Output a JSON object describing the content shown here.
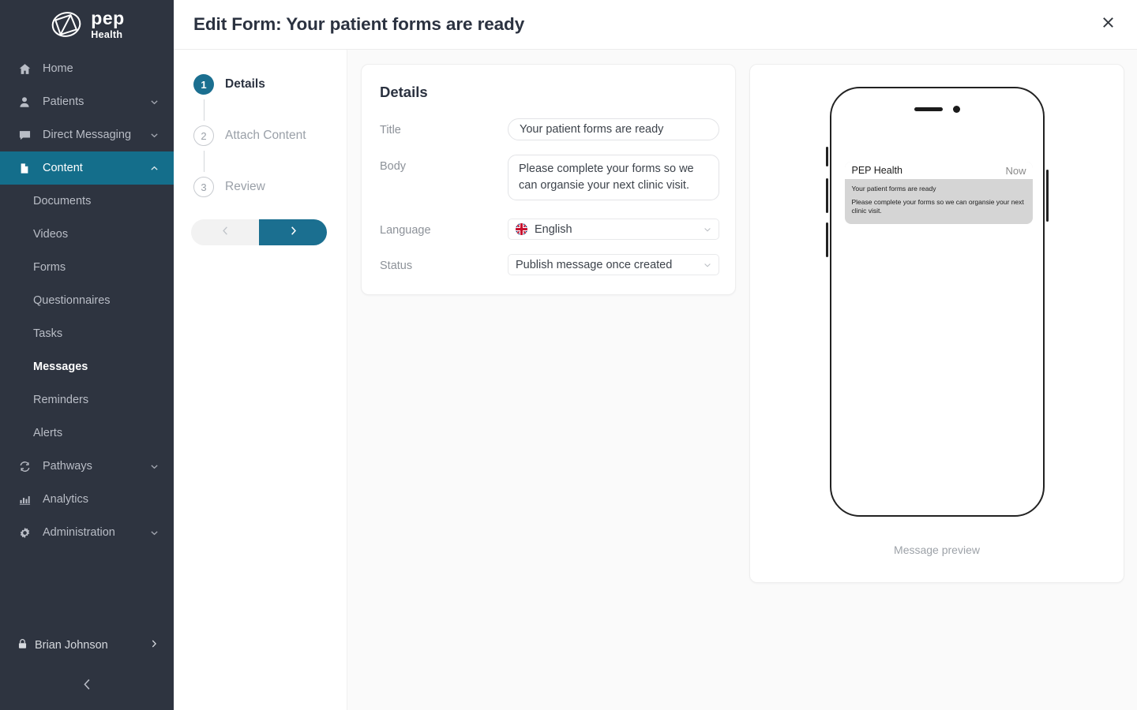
{
  "sidebar": {
    "logo": {
      "primary": "pep",
      "secondary": "Health",
      "icon": "pep-logo-icon"
    },
    "items": [
      {
        "label": "Home",
        "icon": "home-icon",
        "expandable": false,
        "active": false
      },
      {
        "label": "Patients",
        "icon": "person-icon",
        "expandable": true,
        "active": false
      },
      {
        "label": "Direct Messaging",
        "icon": "chat-icon",
        "expandable": true,
        "active": false
      },
      {
        "label": "Content",
        "icon": "document-icon",
        "expandable": true,
        "active": true
      }
    ],
    "content_children": [
      {
        "label": "Documents",
        "current": false
      },
      {
        "label": "Videos",
        "current": false
      },
      {
        "label": "Forms",
        "current": false
      },
      {
        "label": "Questionnaires",
        "current": false
      },
      {
        "label": "Tasks",
        "current": false
      },
      {
        "label": "Messages",
        "current": true
      },
      {
        "label": "Reminders",
        "current": false
      },
      {
        "label": "Alerts",
        "current": false
      }
    ],
    "items_lower": [
      {
        "label": "Pathways",
        "icon": "refresh-icon",
        "expandable": true,
        "active": false
      },
      {
        "label": "Analytics",
        "icon": "bar-chart-icon",
        "expandable": false,
        "active": false
      },
      {
        "label": "Administration",
        "icon": "gear-icon",
        "expandable": true,
        "active": false
      }
    ],
    "user": {
      "name": "Brian Johnson",
      "icon": "lock-icon",
      "chevron": "chevron-right-icon"
    },
    "collapse": {
      "icon": "chevron-left-icon"
    },
    "colors": {
      "background": "#2e3440",
      "active": "#146e8b",
      "text": "#b9bdc6"
    }
  },
  "header": {
    "title": "Edit Form: Your patient forms are ready",
    "close_icon": "close-icon"
  },
  "stepper": {
    "steps": [
      {
        "number": "1",
        "label": "Details",
        "state": "active"
      },
      {
        "number": "2",
        "label": "Attach Content",
        "state": "idle"
      },
      {
        "number": "3",
        "label": "Review",
        "state": "idle"
      }
    ],
    "prev_icon": "chevron-left-icon",
    "next_icon": "chevron-right-icon",
    "accent": "#1b6f90"
  },
  "details": {
    "title": "Details",
    "fields": {
      "title": {
        "label": "Title",
        "value": "Your patient forms are ready",
        "placeholder": ""
      },
      "body": {
        "label": "Body",
        "value": "Please complete your forms so we can organsie your next clinic visit.",
        "placeholder": ""
      },
      "language": {
        "label": "Language",
        "value": "English",
        "flag": "uk-flag-icon",
        "chevron": "chevron-down-icon"
      },
      "status": {
        "label": "Status",
        "value": "Publish message once created",
        "chevron": "chevron-down-icon"
      }
    }
  },
  "preview": {
    "caption": "Message preview",
    "notification": {
      "app_name": "PEP Health",
      "time": "Now",
      "title": "Your patient forms are ready",
      "body": "Please complete your forms so we can organsie your next clinic visit."
    }
  }
}
